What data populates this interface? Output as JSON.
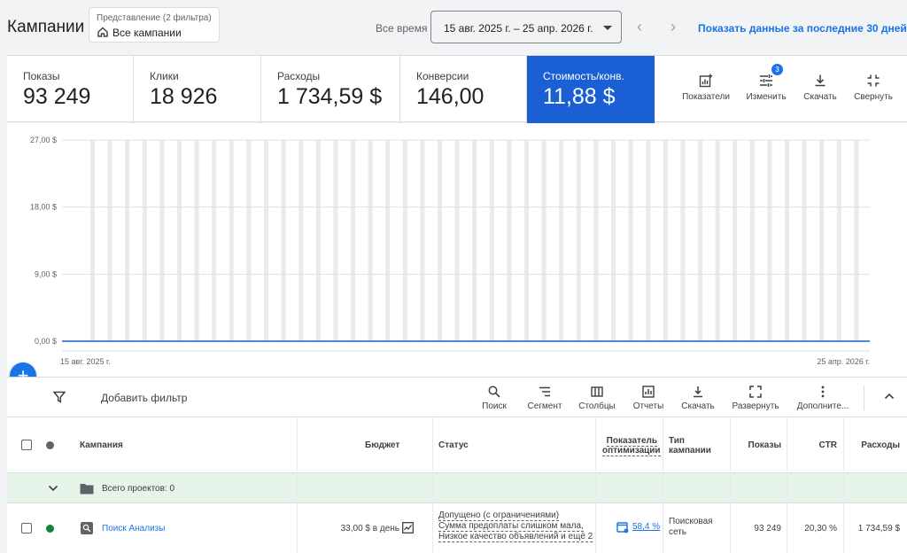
{
  "header": {
    "title": "Кампании",
    "view_label": "Представление (2 фильтра)",
    "view_value": "Все кампании",
    "range_label": "Все время",
    "date_range": "15 авг. 2025 г. – 25 апр. 2026 г.",
    "last30_link": "Показать данные за последние 30 дней",
    "prev_icon": "chevron-left-icon",
    "next_icon": "chevron-right-icon"
  },
  "summary": {
    "cards": [
      {
        "label": "Показы",
        "value": "93 249"
      },
      {
        "label": "Клики",
        "value": "18 926"
      },
      {
        "label": "Расходы",
        "value": "1 734,59 $"
      },
      {
        "label": "Конверсии",
        "value": "146,00"
      },
      {
        "label": "Стоимость/конв.",
        "value": "11,88 $"
      }
    ],
    "tools": [
      {
        "label": "Показатели",
        "icon": "add-chart-icon"
      },
      {
        "label": "Изменить",
        "icon": "tune-icon",
        "badge": "3"
      },
      {
        "label": "Скачать",
        "icon": "download-icon"
      },
      {
        "label": "Свернуть",
        "icon": "collapse-icon"
      }
    ]
  },
  "chart_data": {
    "type": "line",
    "x_start_label": "15 авг. 2025 г.",
    "x_end_label": "25 апр. 2026 г.",
    "y_ticks": [
      "0,00 $",
      "9,00 $",
      "18,00 $",
      "27,00 $"
    ],
    "ylim": [
      0,
      27
    ],
    "grid": true,
    "accent": "#1a5fd4",
    "series": [
      {
        "values": [
          0,
          0,
          0,
          0,
          0,
          0,
          0,
          0,
          0,
          0,
          0,
          0,
          0,
          0,
          0,
          0,
          0,
          0,
          0,
          0,
          0,
          0,
          0,
          0,
          0,
          0,
          0,
          0,
          0,
          0,
          0,
          0,
          0,
          0,
          0,
          0,
          0,
          0,
          0,
          0,
          0,
          0,
          0,
          0,
          0,
          0,
          0,
          0,
          0,
          0,
          0,
          0,
          0,
          0,
          0,
          0,
          0,
          0,
          0,
          0,
          0,
          0,
          0,
          0,
          0,
          0,
          0,
          0,
          0,
          0,
          0,
          0,
          0,
          0,
          0,
          0,
          0,
          0,
          0,
          0,
          0,
          0,
          0,
          0,
          0,
          0,
          0,
          0,
          0,
          0,
          0,
          0,
          0,
          0,
          0,
          0,
          0,
          0,
          0,
          0,
          0,
          0,
          0,
          0,
          0,
          0,
          0,
          0,
          0,
          0,
          0,
          0,
          0,
          0,
          0,
          0,
          0,
          0,
          0,
          0,
          0,
          0,
          0,
          0,
          0,
          0,
          0,
          0,
          0,
          0,
          0,
          0,
          0,
          0,
          0,
          0,
          0,
          0,
          0,
          0,
          0,
          0,
          0,
          0,
          0,
          0,
          0,
          0,
          0,
          0,
          0,
          0,
          0,
          0,
          0,
          0,
          0,
          0,
          0,
          0,
          0,
          0,
          0,
          0,
          0,
          0,
          0,
          0,
          0,
          0,
          0,
          0,
          0,
          0,
          0,
          0,
          0,
          0,
          0,
          0,
          0,
          0,
          0,
          0,
          0,
          0,
          0,
          0,
          0,
          0,
          0,
          0,
          0,
          0,
          0,
          0,
          0,
          0,
          0,
          0,
          0,
          0,
          0,
          0,
          0,
          0,
          0,
          0,
          0,
          0,
          0,
          0,
          0,
          0,
          0,
          0,
          0,
          0,
          0,
          0,
          0,
          0,
          0,
          0,
          0,
          0,
          0,
          0,
          0,
          0,
          0,
          0,
          0,
          0,
          0,
          0,
          0,
          0,
          0,
          0,
          0,
          0,
          0,
          0,
          0,
          0,
          0,
          0,
          0,
          0,
          0,
          0,
          0,
          0,
          0,
          0,
          0,
          0,
          0,
          0,
          0,
          0,
          0,
          0,
          0,
          0,
          0,
          0,
          0
        ]
      }
    ]
  },
  "fab_icon": "plus-icon",
  "filterbar": {
    "add_filter": "Добавить фильтр",
    "tools": [
      {
        "label": "Поиск",
        "icon": "search-icon"
      },
      {
        "label": "Сегмент",
        "icon": "segment-icon"
      },
      {
        "label": "Столбцы",
        "icon": "columns-icon"
      },
      {
        "label": "Отчеты",
        "icon": "reports-icon"
      },
      {
        "label": "Скачать",
        "icon": "download-icon"
      },
      {
        "label": "Развернуть",
        "icon": "fullscreen-icon"
      },
      {
        "label": "Дополните...",
        "icon": "more-vert-icon"
      }
    ]
  },
  "table": {
    "headers": {
      "campaign": "Кампания",
      "budget": "Бюджет",
      "status": "Статус",
      "opt_line1": "Показатель",
      "opt_line2": "оптимизации",
      "type_line1": "Тип",
      "type_line2": "кампании",
      "impressions": "Показы",
      "ctr": "CTR",
      "spend": "Расходы"
    },
    "total_row": {
      "label": "Всего проектов: 0"
    },
    "rows": [
      {
        "status_color": "#188038",
        "campaign": "Поиск Анализы",
        "budget": "33,00 $ в день",
        "status_line1": "Допущено (с ограничениями)",
        "status_line2": "Сумма предоплаты слишком мала,",
        "status_line3": "Низкое качество объявлений и ещё 2",
        "optimization": "58,4 %",
        "type_line1": "Поисковая",
        "type_line2": "сеть",
        "impressions": "93 249",
        "ctr": "20,30 %",
        "spend": "1 734,59 $"
      }
    ]
  }
}
